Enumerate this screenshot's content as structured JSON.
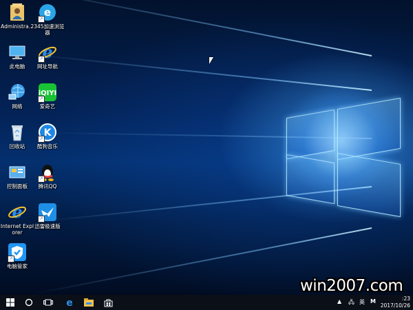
{
  "desktop_icons": [
    {
      "label": "Administra...",
      "icon": "user-folder-icon"
    },
    {
      "label": "2345加速浏览器",
      "icon": "browser-2345-icon"
    },
    {
      "label": "此电脑",
      "icon": "computer-icon"
    },
    {
      "label": "网址导航",
      "icon": "ie-navigation-icon"
    },
    {
      "label": "网络",
      "icon": "network-icon"
    },
    {
      "label": "爱奇艺",
      "icon": "iqiyi-icon"
    },
    {
      "label": "回收站",
      "icon": "recycle-bin-icon"
    },
    {
      "label": "酷狗音乐",
      "icon": "kugou-icon"
    },
    {
      "label": "控制面板",
      "icon": "control-panel-icon"
    },
    {
      "label": "腾讯QQ",
      "icon": "qq-icon"
    },
    {
      "label": "Internet Explorer",
      "icon": "ie-icon"
    },
    {
      "label": "迅雷极速版",
      "icon": "xunlei-icon"
    },
    {
      "label": "电脑管家",
      "icon": "pc-manager-icon"
    }
  ],
  "taskbar": {
    "pinned": [
      "start-icon",
      "cortana-icon",
      "task-view-icon",
      "edge-icon",
      "file-explorer-icon",
      "store-icon"
    ],
    "tray": {
      "ime": "英",
      "ime_mode": "M"
    },
    "clock": {
      "time": ":23",
      "date": "2017/10/26"
    }
  },
  "watermark": "win2007.com",
  "colors": {
    "accent": "#1e8cff",
    "taskbar": "#0a0f18"
  }
}
